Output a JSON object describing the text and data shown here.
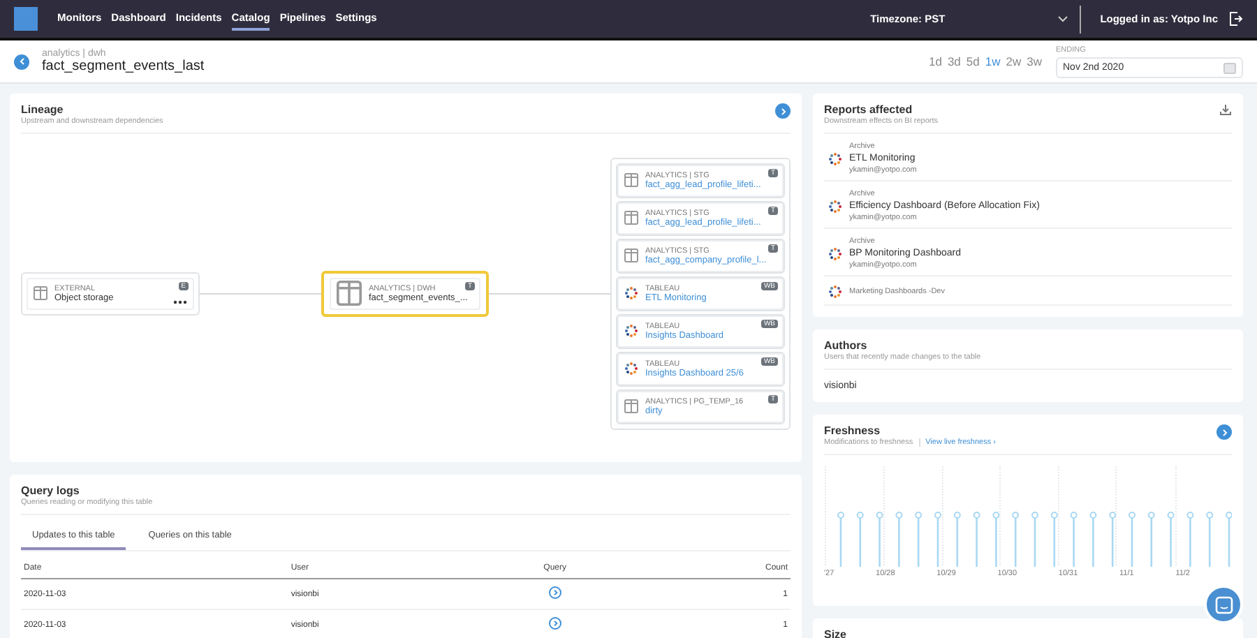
{
  "nav": {
    "items": [
      {
        "label": "Monitors",
        "selected": false
      },
      {
        "label": "Dashboard",
        "selected": false
      },
      {
        "label": "Incidents",
        "selected": false
      },
      {
        "label": "Catalog",
        "selected": true
      },
      {
        "label": "Pipelines",
        "selected": false
      },
      {
        "label": "Settings",
        "selected": false
      }
    ],
    "timezone": "Timezone: PST",
    "user": "Logged in as: Yotpo Inc"
  },
  "header": {
    "breadcrumb": "analytics | dwh",
    "title": "fact_segment_events_last",
    "ranges": [
      {
        "label": "1d",
        "selected": false
      },
      {
        "label": "3d",
        "selected": false
      },
      {
        "label": "5d",
        "selected": false
      },
      {
        "label": "1w",
        "selected": true
      },
      {
        "label": "2w",
        "selected": false
      },
      {
        "label": "3w",
        "selected": false
      }
    ],
    "ending_label": "ENDING",
    "ending_value": "Nov 2nd 2020"
  },
  "lineage": {
    "title": "Lineage",
    "subtitle": "Upstream and downstream dependencies",
    "upstream": {
      "source": "EXTERNAL",
      "name": "Object storage",
      "badge": "E"
    },
    "center": {
      "source": "ANALYTICS | DWH",
      "name": "fact_segment_events_...",
      "badge": "T"
    },
    "downstream": [
      {
        "kind": "table",
        "source": "ANALYTICS | STG",
        "name": "fact_agg_lead_profile_lifeti...",
        "badge": "T"
      },
      {
        "kind": "table",
        "source": "ANALYTICS | STG",
        "name": "fact_agg_lead_profile_lifeti...",
        "badge": "T"
      },
      {
        "kind": "table",
        "source": "ANALYTICS | STG",
        "name": "fact_agg_company_profile_l...",
        "badge": "T"
      },
      {
        "kind": "tableau",
        "source": "TABLEAU",
        "name": "ETL Monitoring",
        "badge": "WB"
      },
      {
        "kind": "tableau",
        "source": "TABLEAU",
        "name": "Insights Dashboard",
        "badge": "WB"
      },
      {
        "kind": "tableau",
        "source": "TABLEAU",
        "name": "Insights Dashboard 25/6",
        "badge": "WB"
      },
      {
        "kind": "table",
        "source": "ANALYTICS | PG_TEMP_16",
        "name": "dirty",
        "badge": "T"
      }
    ]
  },
  "query_logs": {
    "title": "Query logs",
    "subtitle": "Queries reading or modifying this table",
    "tabs": [
      {
        "label": "Updates to this table",
        "selected": true
      },
      {
        "label": "Queries on this table",
        "selected": false
      }
    ],
    "columns": [
      "Date",
      "User",
      "Query",
      "Count"
    ],
    "rows": [
      {
        "date": "2020-11-03",
        "user": "visionbi",
        "count": "1"
      },
      {
        "date": "2020-11-03",
        "user": "visionbi",
        "count": "1"
      }
    ]
  },
  "reports": {
    "title": "Reports affected",
    "subtitle": "Downstream effects on BI reports",
    "items": [
      {
        "folder": "Archive",
        "name": "ETL Monitoring",
        "owner": "ykamin@yotpo.com"
      },
      {
        "folder": "Archive",
        "name": "Efficiency Dashboard (Before Allocation Fix)",
        "owner": "ykamin@yotpo.com"
      },
      {
        "folder": "Archive",
        "name": "BP Monitoring Dashboard",
        "owner": "ykamin@yotpo.com"
      },
      {
        "folder": "Marketing Dashboards -Dev"
      }
    ]
  },
  "authors": {
    "title": "Authors",
    "subtitle": "Users that recently made changes to the table",
    "names": [
      "visionbi"
    ]
  },
  "freshness": {
    "title": "Freshness",
    "subtitle": "Modifications to freshness",
    "link": "View live freshness ›",
    "x_labels": [
      "'27",
      "10/28",
      "10/29",
      "10/30",
      "10/31",
      "11/1",
      "11/2"
    ]
  },
  "size": {
    "title": "Size"
  }
}
